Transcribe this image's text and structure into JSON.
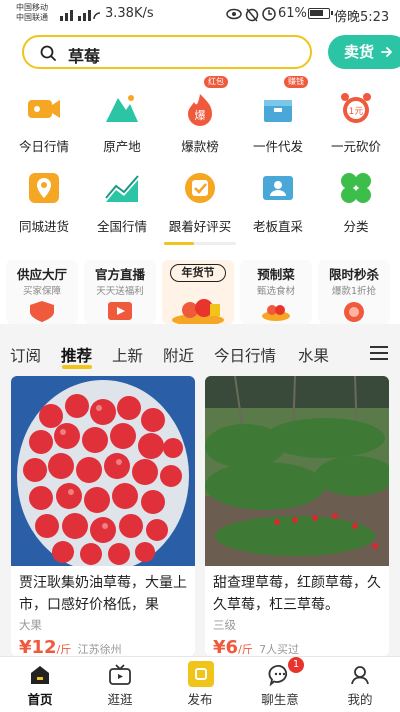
{
  "status_bar": {
    "carrier_1": "中国移动",
    "carrier_2": "中国联通",
    "speed": "3.38K/s",
    "battery": "61%",
    "time": "傍晚5:23"
  },
  "search": {
    "query": "草莓"
  },
  "header": {
    "sell_label": "卖货"
  },
  "categories": [
    {
      "label": "今日行情",
      "icon": "video-camera-icon"
    },
    {
      "label": "原产地",
      "icon": "mountain-icon"
    },
    {
      "label": "爆款榜",
      "icon": "fire-icon",
      "tag": "红包"
    },
    {
      "label": "一件代发",
      "icon": "box-icon",
      "tag": "赚钱"
    },
    {
      "label": "一元砍价",
      "icon": "alarm-clock-icon"
    },
    {
      "label": "同城进货",
      "icon": "location-pin-icon"
    },
    {
      "label": "全国行情",
      "icon": "trend-chart-icon"
    },
    {
      "label": "跟着好评买",
      "icon": "rating-badge-icon"
    },
    {
      "label": "老板直采",
      "icon": "contact-card-icon"
    },
    {
      "label": "分类",
      "icon": "clover-icon"
    }
  ],
  "promos": [
    {
      "title": "供应大厅",
      "subtitle": "买家保障"
    },
    {
      "title": "官方直播",
      "subtitle": "天天送福利"
    },
    {
      "title": "年货节",
      "subtitle": ""
    },
    {
      "title": "预制菜",
      "subtitle": "甄选食材"
    },
    {
      "title": "限时秒杀",
      "subtitle": "爆款1折抢"
    }
  ],
  "tabs": [
    {
      "label": "订阅"
    },
    {
      "label": "推荐"
    },
    {
      "label": "上新"
    },
    {
      "label": "附近"
    },
    {
      "label": "今日行情"
    },
    {
      "label": "水果"
    }
  ],
  "products": [
    {
      "title": "贾汪耿集奶油草莓，大量上市，口感好价格低，果",
      "meta": "大果",
      "price": "¥12",
      "price_unit": "/斤",
      "price_extra": "江苏徐州"
    },
    {
      "title": "甜查理草莓，红颜草莓，久久草莓，杠三草莓。",
      "meta": "三级",
      "price": "¥6",
      "price_unit": "/斤",
      "price_extra": "7人买过"
    }
  ],
  "bottom_nav": [
    {
      "label": "首页",
      "icon": "home-icon"
    },
    {
      "label": "逛逛",
      "icon": "tv-icon"
    },
    {
      "label": "发布",
      "icon": "publish-icon"
    },
    {
      "label": "聊生意",
      "icon": "chat-icon",
      "badge": "1"
    },
    {
      "label": "我的",
      "icon": "profile-icon"
    }
  ],
  "colors": {
    "accent_yellow": "#f0c419",
    "brand_teal": "#2bc4a4",
    "price_red": "#f05a3c",
    "badge_red": "#e8342c"
  }
}
